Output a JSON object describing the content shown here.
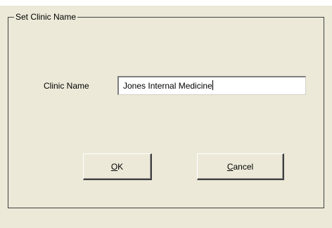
{
  "dialog": {
    "group_title": "Set Clinic Name",
    "clinic_name_label": "Clinic Name",
    "clinic_name_value": "Jones Internal Medicine",
    "ok_label": {
      "mnemonic": "O",
      "rest": "K"
    },
    "cancel_label": {
      "mnemonic": "C",
      "rest": "ancel"
    }
  }
}
